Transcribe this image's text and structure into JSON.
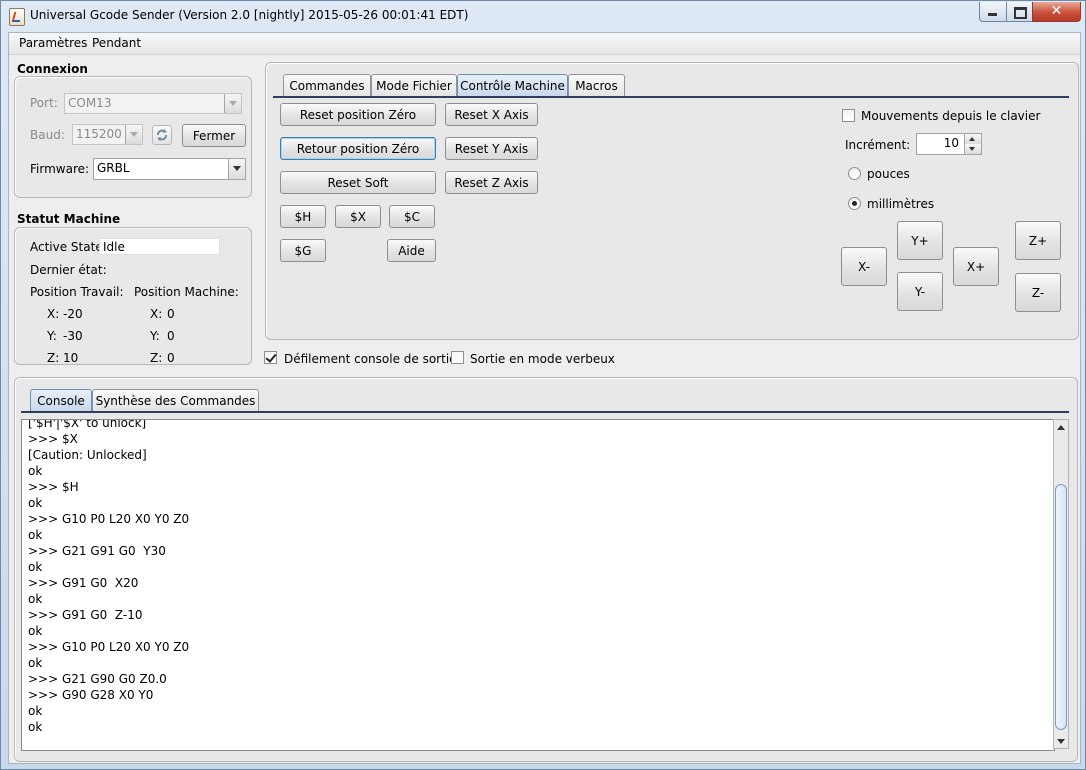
{
  "window": {
    "title": "Universal Gcode Sender (Version 2.0 [nightly]  2015-05-26 00:01:41 EDT)",
    "close_label": "✕"
  },
  "menu": [
    "Paramètres",
    "Pendant"
  ],
  "connexion": {
    "title": "Connexion",
    "port_label": "Port:",
    "port_value": "COM13",
    "baud_label": "Baud:",
    "baud_value": "115200",
    "close_button": "Fermer",
    "firmware_label": "Firmware:",
    "firmware_value": "GRBL",
    "refresh_icon": "refresh-icon"
  },
  "status": {
    "title": "Statut Machine",
    "active_state_label": "Active State:",
    "active_state_value": "Idle",
    "last_state_label": "Dernier état:",
    "work_pos_label": "Position Travail:",
    "machine_pos_label": "Position Machine:",
    "work": {
      "x_label": "X:",
      "x": "-20",
      "y_label": "Y:",
      "y": "-30",
      "z_label": "Z:",
      "z": "10"
    },
    "machine": {
      "x_label": "X:",
      "x": "0",
      "y_label": "Y:",
      "y": "0",
      "z_label": "Z:",
      "z": "0"
    }
  },
  "tabs": [
    "Commandes",
    "Mode Fichier",
    "Contrôle Machine",
    "Macros"
  ],
  "selected_tab": "Contrôle Machine",
  "machine_control": {
    "reset_zero": "Reset position Zéro",
    "return_zero": "Retour position Zéro",
    "soft_reset": "Reset Soft",
    "reset_x": "Reset X Axis",
    "reset_y": "Reset Y Axis",
    "reset_z": "Reset Z Axis",
    "home": "$H",
    "unlock": "$X",
    "check": "$C",
    "gcode_state": "$G",
    "help": "Aide",
    "keyboard_label": "Mouvements depuis le clavier",
    "keyboard_checked": false,
    "increment_label": "Incrément:",
    "increment_value": "10",
    "unit_inches": "pouces",
    "unit_mm": "millimètres",
    "selected_unit": "millimètres",
    "jog": {
      "x_minus": "X-",
      "x_plus": "X+",
      "y_plus": "Y+",
      "y_minus": "Y-",
      "z_plus": "Z+",
      "z_minus": "Z-"
    }
  },
  "options": {
    "scroll_output_label": "Défilement console de sortie",
    "scroll_output_checked": true,
    "verbose_label": "Sortie en mode verbeux",
    "verbose_checked": false
  },
  "console_tabs": [
    "Console",
    "Synthèse des Commandes"
  ],
  "console_lines": [
    "['$H'|'$X' to unlock]",
    ">>> $X",
    "[Caution: Unlocked]",
    "ok",
    ">>> $H",
    "ok",
    ">>> G10 P0 L20 X0 Y0 Z0",
    "ok",
    ">>> G21 G91 G0  Y30",
    "ok",
    ">>> G91 G0  X20",
    "ok",
    ">>> G91 G0  Z-10",
    "ok",
    ">>> G10 P0 L20 X0 Y0 Z0",
    "ok",
    ">>> G21 G90 G0 Z0.0",
    ">>> G90 G28 X0 Y0",
    "ok",
    "ok"
  ],
  "colors": {
    "selected_tab": "#c9d8eb",
    "title_bar": "#dfe9f5",
    "close_button": "#c9503b"
  }
}
